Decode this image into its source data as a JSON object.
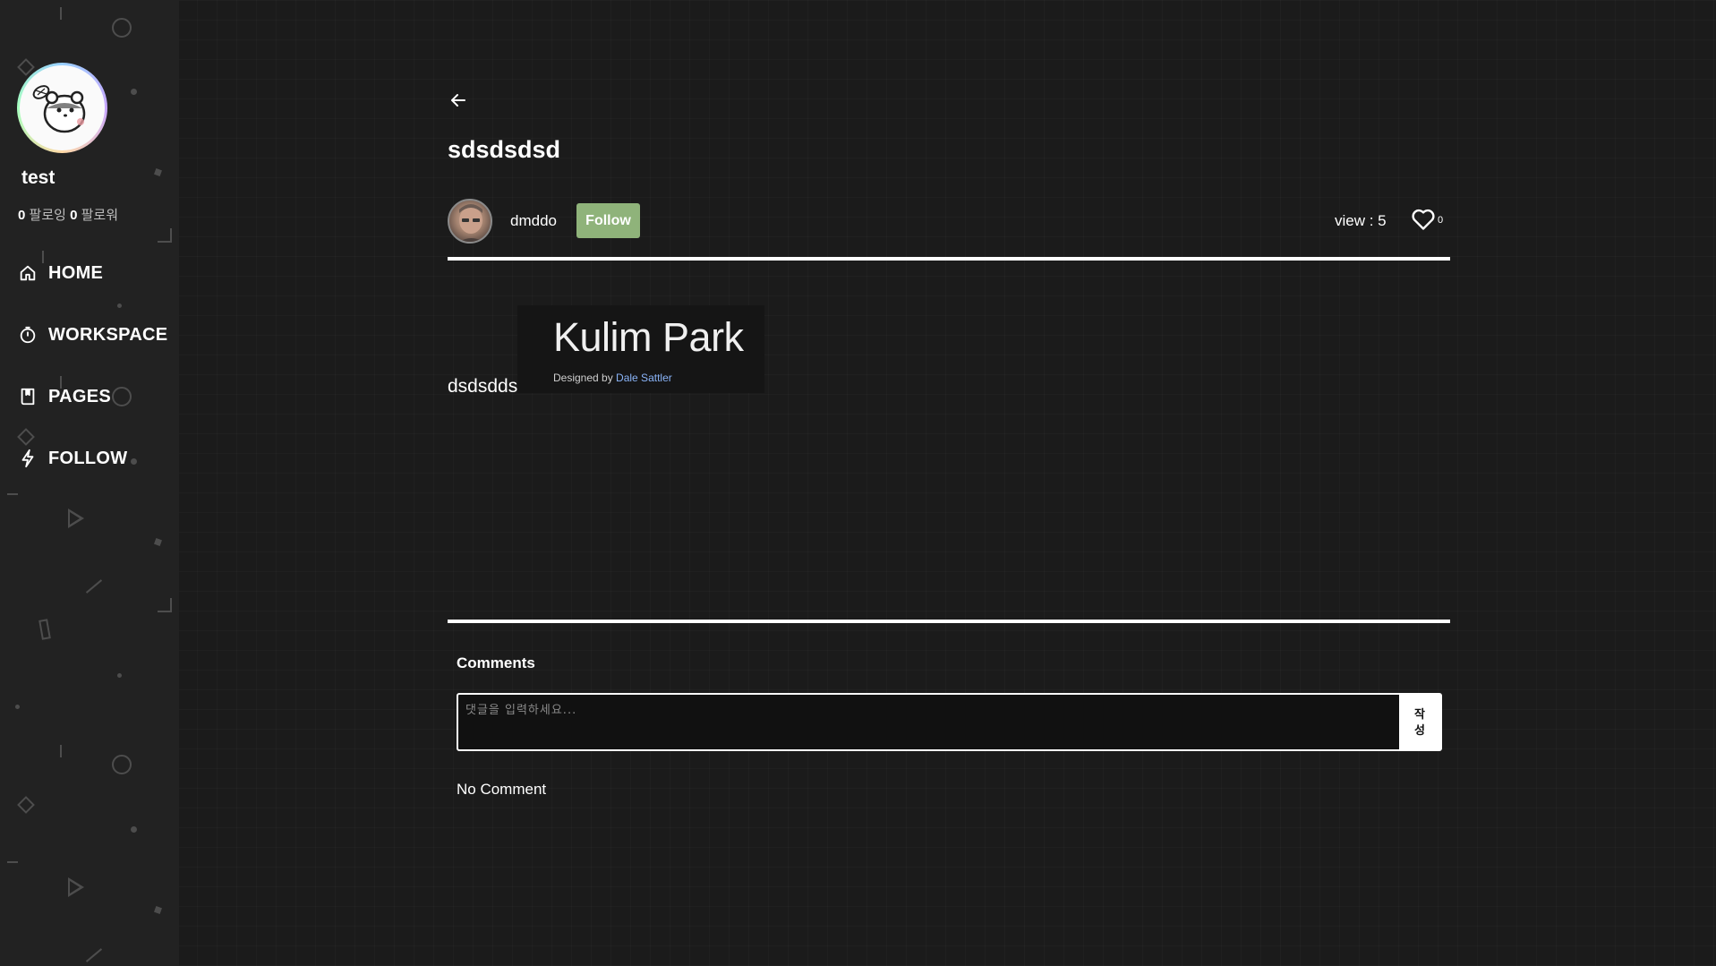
{
  "sidebar": {
    "username": "test",
    "following_count": "0",
    "following_label": "팔로잉",
    "follower_count": "0",
    "follower_label": "팔로워",
    "nav": [
      {
        "label": "HOME",
        "icon": "home-icon"
      },
      {
        "label": "WORKSPACE",
        "icon": "timer-icon"
      },
      {
        "label": "PAGES",
        "icon": "book-icon"
      },
      {
        "label": "FOLLOW",
        "icon": "lightning-icon"
      }
    ]
  },
  "post": {
    "title": "sdsdsdsd",
    "author": "dmddo",
    "follow_label": "Follow",
    "views": "view : 5",
    "likes": "0",
    "body_text": "dsdsdds",
    "embed": {
      "title": "Kulim Park",
      "designed_by": "Designed by ",
      "designer": "Dale Sattler"
    }
  },
  "comments": {
    "title": "Comments",
    "placeholder": "댓글을 입력하세요...",
    "submit_label": "작성",
    "empty_text": "No Comment"
  },
  "colors": {
    "background": "#1b1b1b",
    "sidebar": "#222222",
    "follow_button": "#8fb37a",
    "link": "#8ab4f8"
  }
}
